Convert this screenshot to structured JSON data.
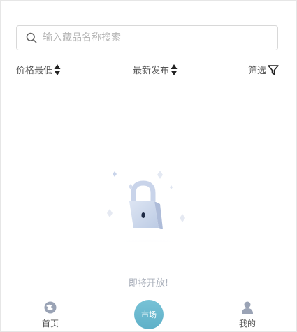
{
  "search": {
    "placeholder": "输入藏品名称搜索",
    "value": ""
  },
  "filters": [
    {
      "label": "价格最低",
      "icon": "sort-icon"
    },
    {
      "label": "最新发布",
      "icon": "sort-icon"
    },
    {
      "label": "筛选",
      "icon": "filter-icon"
    }
  ],
  "empty_state": {
    "message": "即将开放!",
    "icon": "lock-illustration"
  },
  "tabbar": {
    "home_label": "首页",
    "market_label": "市场",
    "mine_label": "我的",
    "home_icon": "home-logo-icon",
    "mine_icon": "user-icon"
  },
  "colors": {
    "market_accent": "#6bb8cf",
    "muted_text": "#aab0bb"
  }
}
